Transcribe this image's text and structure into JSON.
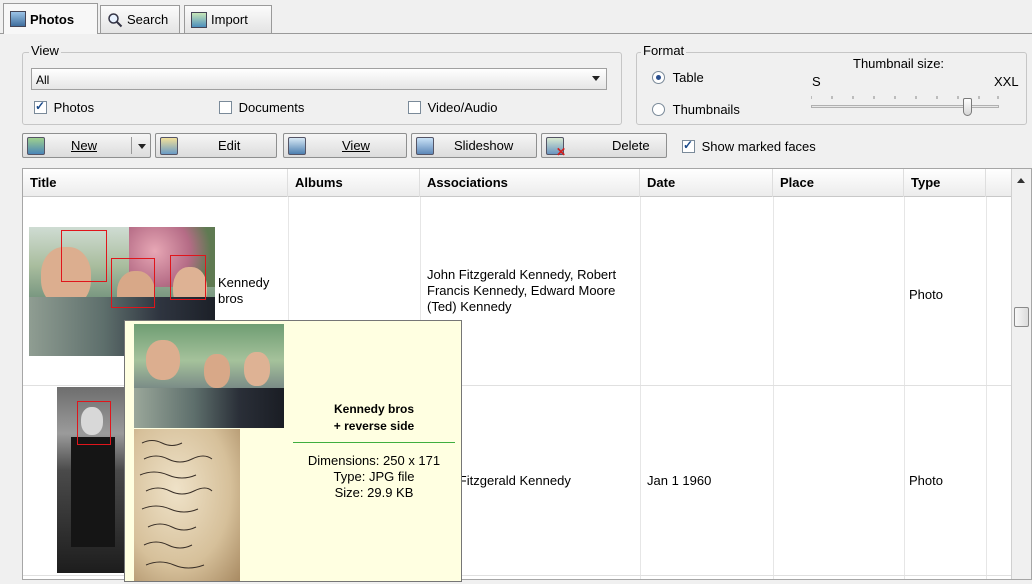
{
  "tabs": [
    {
      "label": "Photos",
      "icon": "photos-icon"
    },
    {
      "label": "Search",
      "icon": "search-icon"
    },
    {
      "label": "Import",
      "icon": "import-icon"
    }
  ],
  "view": {
    "legend": "View",
    "filter_value": "All",
    "checkboxes": [
      {
        "label": "Photos",
        "checked": true
      },
      {
        "label": "Documents",
        "checked": false
      },
      {
        "label": "Video/Audio",
        "checked": false
      }
    ]
  },
  "format": {
    "legend": "Format",
    "options": [
      {
        "label": "Table",
        "selected": true
      },
      {
        "label": "Thumbnails",
        "selected": false
      }
    ],
    "thumb_label": "Thumbnail size:",
    "min_label": "S",
    "max_label": "XXL",
    "thumb_level": 0.83
  },
  "toolbar": {
    "new": "New",
    "edit": "Edit",
    "view": "View",
    "slideshow": "Slideshow",
    "delete": "Delete",
    "show_faces": "Show marked faces",
    "show_faces_checked": true
  },
  "table": {
    "columns": [
      "Title",
      "Albums",
      "Associations",
      "Date",
      "Place",
      "Type"
    ],
    "rows": [
      {
        "title": "Kennedy bros",
        "albums": "",
        "associations": "John Fitzgerald Kennedy, Robert Francis Kennedy, Edward Moore (Ted) Kennedy",
        "date": "",
        "place": "",
        "type": "Photo"
      },
      {
        "title": "",
        "albums": "",
        "associations": "John Fitzgerald Kennedy",
        "date": "Jan 1 1960",
        "place": "",
        "type": "Photo"
      }
    ]
  },
  "tooltip": {
    "title_line1": "Kennedy bros",
    "title_line2": "+ reverse side",
    "dimensions": "Dimensions: 250 x 171",
    "type": "Type: JPG file",
    "size": "Size: 29.9 KB"
  },
  "colors": {
    "face_marker": "#e0151b",
    "tooltip_bg": "#ffffe1",
    "tooltip_divider": "#3fae3f"
  }
}
